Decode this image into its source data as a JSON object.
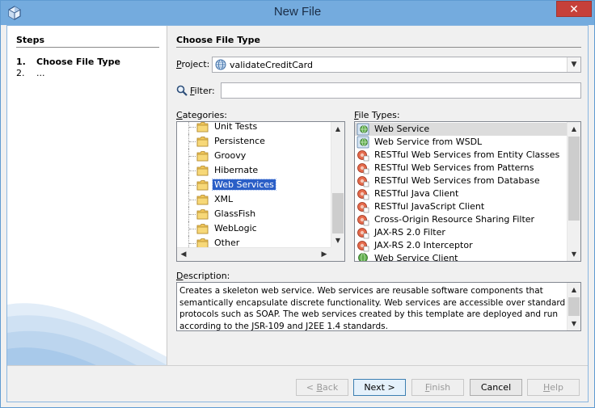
{
  "window": {
    "title": "New File",
    "close_glyph": "✕"
  },
  "steps": {
    "title": "Steps",
    "items": [
      {
        "num": "1.",
        "label": "Choose File Type"
      },
      {
        "num": "2.",
        "label": "..."
      }
    ]
  },
  "main": {
    "title": "Choose File Type",
    "project_label_u": "P",
    "project_label_rest": "roject:",
    "project_value": "validateCreditCard",
    "filter_label_u": "F",
    "filter_label_rest": "ilter:",
    "filter_value": "",
    "categories_label_u": "C",
    "categories_label_rest": "ategories:",
    "file_types_label_u": "F",
    "file_types_label_rest": "ile Types:",
    "description_label_u": "D",
    "description_label_rest": "escription:"
  },
  "categories": {
    "items": [
      {
        "label": "Unit Tests",
        "icon": "folder-icon",
        "selected": false
      },
      {
        "label": "Persistence",
        "icon": "folder-icon",
        "selected": false
      },
      {
        "label": "Groovy",
        "icon": "folder-icon",
        "selected": false
      },
      {
        "label": "Hibernate",
        "icon": "folder-icon",
        "selected": false
      },
      {
        "label": "Web Services",
        "icon": "folder-icon",
        "selected": true
      },
      {
        "label": "XML",
        "icon": "folder-icon",
        "selected": false
      },
      {
        "label": "GlassFish",
        "icon": "folder-icon",
        "selected": false
      },
      {
        "label": "WebLogic",
        "icon": "folder-icon",
        "selected": false
      },
      {
        "label": "Other",
        "icon": "folder-icon",
        "selected": false
      }
    ]
  },
  "file_types": {
    "items": [
      {
        "label": "Web Service",
        "icon": "web-service-icon",
        "selected": true
      },
      {
        "label": "Web Service from WSDL",
        "icon": "web-service-icon",
        "selected": false
      },
      {
        "label": "RESTful Web Services from Entity Classes",
        "icon": "restful-icon",
        "selected": false
      },
      {
        "label": "RESTful Web Services from Patterns",
        "icon": "restful-icon",
        "selected": false
      },
      {
        "label": "RESTful Web Services from Database",
        "icon": "restful-icon",
        "selected": false
      },
      {
        "label": "RESTful Java Client",
        "icon": "restful-icon",
        "selected": false
      },
      {
        "label": "RESTful JavaScript Client",
        "icon": "restful-icon",
        "selected": false
      },
      {
        "label": "Cross-Origin Resource Sharing Filter",
        "icon": "restful-icon",
        "selected": false
      },
      {
        "label": "JAX-RS 2.0 Filter",
        "icon": "restful-icon",
        "selected": false
      },
      {
        "label": "JAX-RS 2.0 Interceptor",
        "icon": "restful-icon",
        "selected": false
      },
      {
        "label": "Web Service Client",
        "icon": "web-service-client-icon",
        "selected": false
      }
    ]
  },
  "description": {
    "text": "Creates a skeleton web service. Web services are reusable software components that semantically encapsulate discrete functionality. Web services are accessible over standard protocols such as SOAP. The web services created by this template are deployed and run according to the JSR-109 and J2EE 1.4 standards."
  },
  "buttons": {
    "back_prefix": "< ",
    "back_u": "B",
    "back_rest": "ack",
    "next": "Next >",
    "finish_u": "F",
    "finish_rest": "inish",
    "cancel": "Cancel",
    "help_u": "H",
    "help_rest": "elp"
  },
  "colors": {
    "titlebar": "#74abde",
    "selection": "#2b5fc7",
    "close": "#c6403a"
  }
}
